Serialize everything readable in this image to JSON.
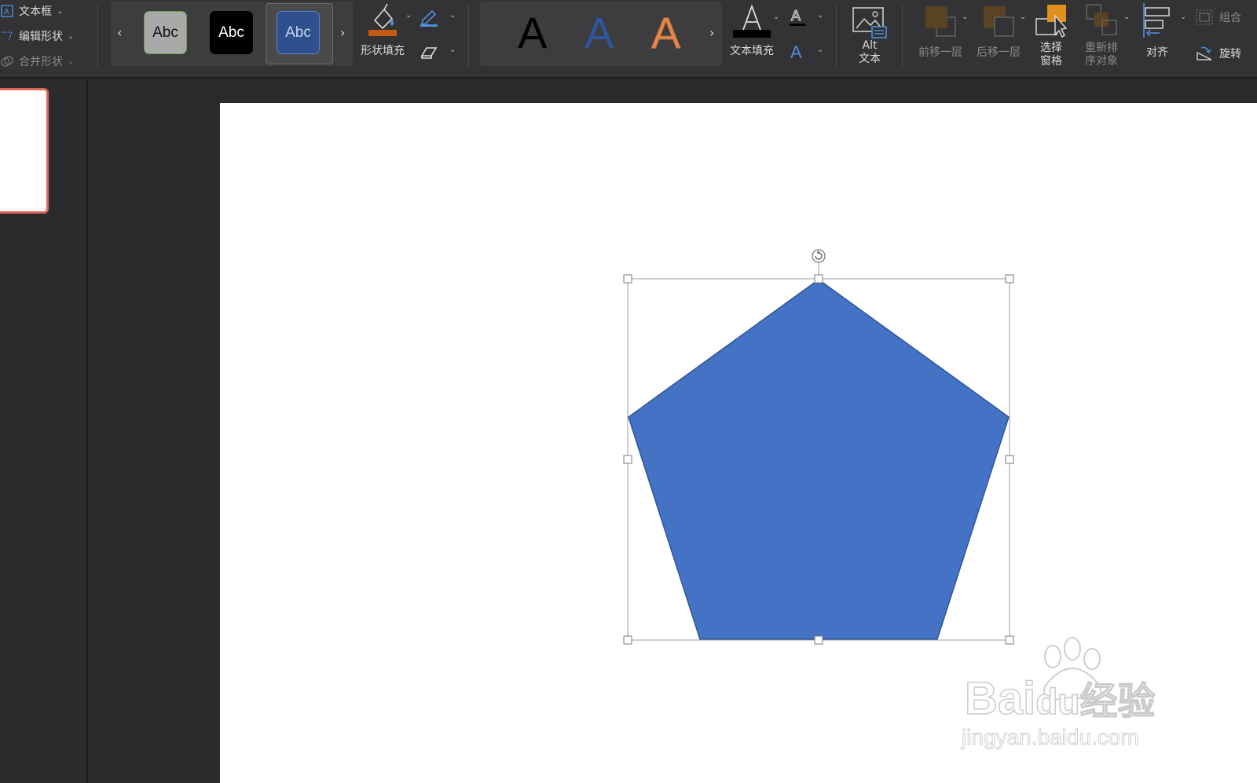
{
  "ribbon": {
    "insert_group": {
      "text_box": "文本框",
      "edit_shape": "编辑形状",
      "merge_shapes": "合并形状"
    },
    "shape_styles": {
      "presets": [
        {
          "label": "Abc",
          "bg": "#a9a9a9",
          "fg": "#111111",
          "border": "#6aa04d"
        },
        {
          "label": "Abc",
          "bg": "#000000",
          "fg": "#ffffff",
          "border": "#000000"
        },
        {
          "label": "Abc",
          "bg": "#2f4f8f",
          "fg": "#c8d4ec",
          "border": "#5b82c6"
        }
      ],
      "shape_fill_label": "形状填充",
      "shape_fill_color": "#c55a11"
    },
    "wordart": {
      "letters": [
        {
          "char": "A",
          "color": "#000000"
        },
        {
          "char": "A",
          "color": "#2f55a0"
        },
        {
          "char": "A",
          "color": "#e08a4f"
        }
      ],
      "text_fill_label": "文本填充"
    },
    "alt_text": {
      "line1": "Alt",
      "line2": "文本"
    },
    "arrange": {
      "bring_forward": "前移一层",
      "send_backward": "后移一层",
      "selection_pane_line1": "选择",
      "selection_pane_line2": "窗格",
      "reorder_line1": "重新排",
      "reorder_line2": "序对象",
      "align": "对齐",
      "group": "组合",
      "rotate": "旋转"
    }
  },
  "slide": {
    "shape": {
      "type": "pentagon",
      "fill": "#4472c4",
      "outline": "#2f5597",
      "selected": true
    }
  },
  "watermark": {
    "brand": "Bai",
    "brand_mid": "du",
    "brand_cn": "经验",
    "url": "jingyan.baidu.com"
  }
}
